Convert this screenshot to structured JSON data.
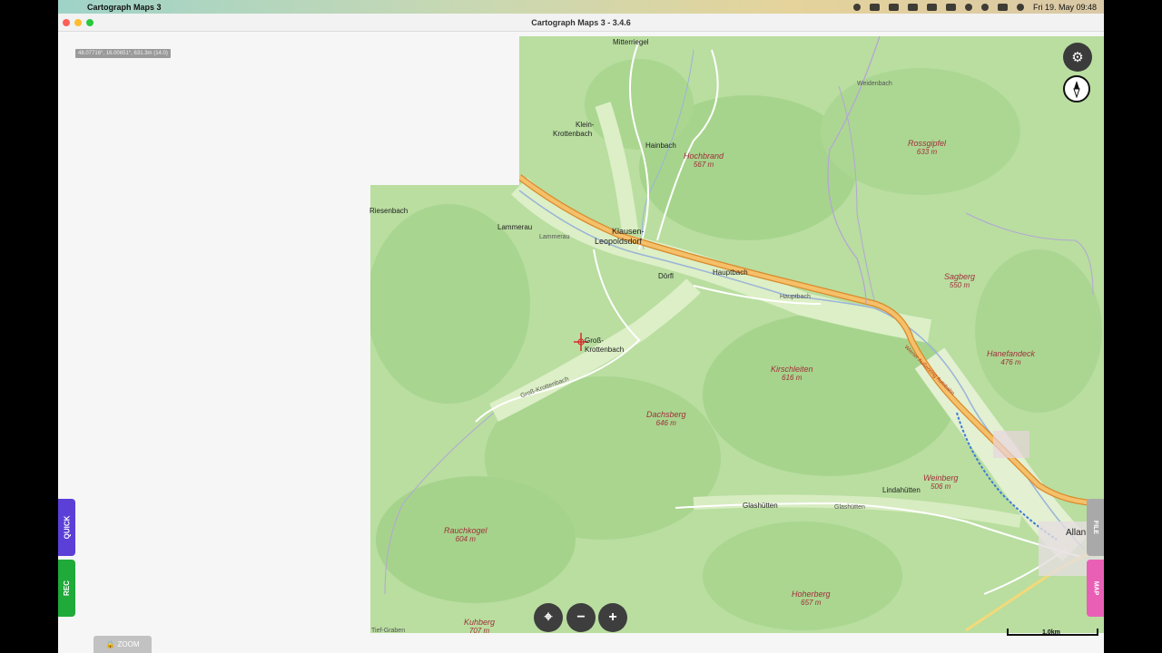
{
  "menubar": {
    "apple_icon": "apple-logo",
    "app_name": "Cartograph Maps 3",
    "clock": "Fri 19. May  09:48"
  },
  "window": {
    "title": "Cartograph Maps 3 - 3.4.6"
  },
  "coords_readout": "48.07716°, 16.00651°, 631.3m (14.0)",
  "places": {
    "mitterriegel": "Mitterriegel",
    "klein_krottenbach_1": "Klein-",
    "klein_krottenbach_2": "Krottenbach",
    "hainbach": "Hainbach",
    "riesenbach": "Riesenbach",
    "lammerau": "Lammerau",
    "klausen_1": "Klausen-",
    "klausen_2": "Leopoldsdorf",
    "dorfl": "Dörfl",
    "hauptbach": "Hauptbach",
    "gross_krottenbach_1": "Groß-",
    "gross_krottenbach_2": "Krottenbach",
    "glashutten": "Glashütten",
    "lindahutten": "Lindahütten",
    "alland": "Allan",
    "weidenbach": "Weidenbach",
    "hauptbach_small": "Hauptbach",
    "lammerau_small": "Lammerau",
    "glashutten_small": "Glashütten",
    "tiefgraben": "Tief-Graben",
    "gross_krottenbach_small": "Groß-Krottenbach"
  },
  "peaks": [
    {
      "name": "Hochbrand",
      "elev": "567 m"
    },
    {
      "name": "Rossgipfel",
      "elev": "633 m"
    },
    {
      "name": "Sagberg",
      "elev": "550 m"
    },
    {
      "name": "Hanefandeck",
      "elev": "476 m"
    },
    {
      "name": "Kirschleiten",
      "elev": "616 m"
    },
    {
      "name": "Dachsberg",
      "elev": "646 m"
    },
    {
      "name": "Weinberg",
      "elev": "506 m"
    },
    {
      "name": "Rauchkogel",
      "elev": "604 m"
    },
    {
      "name": "Hoherberg",
      "elev": "657 m"
    },
    {
      "name": "Kuhberg",
      "elev": "707 m"
    }
  ],
  "road_labels": {
    "highway": "Wiener Außenring Autobahn"
  },
  "controls": {
    "settings_icon": "gear-icon",
    "compass_icon": "compass-icon",
    "locate_glyph": "⌖",
    "zoom_out_glyph": "−",
    "zoom_in_glyph": "+"
  },
  "tabs": {
    "quick": "QUICK",
    "rec": "REC",
    "file": "FILE",
    "map": "MAP",
    "zoom_lock": "ZOOM"
  },
  "scale": "1.0km"
}
